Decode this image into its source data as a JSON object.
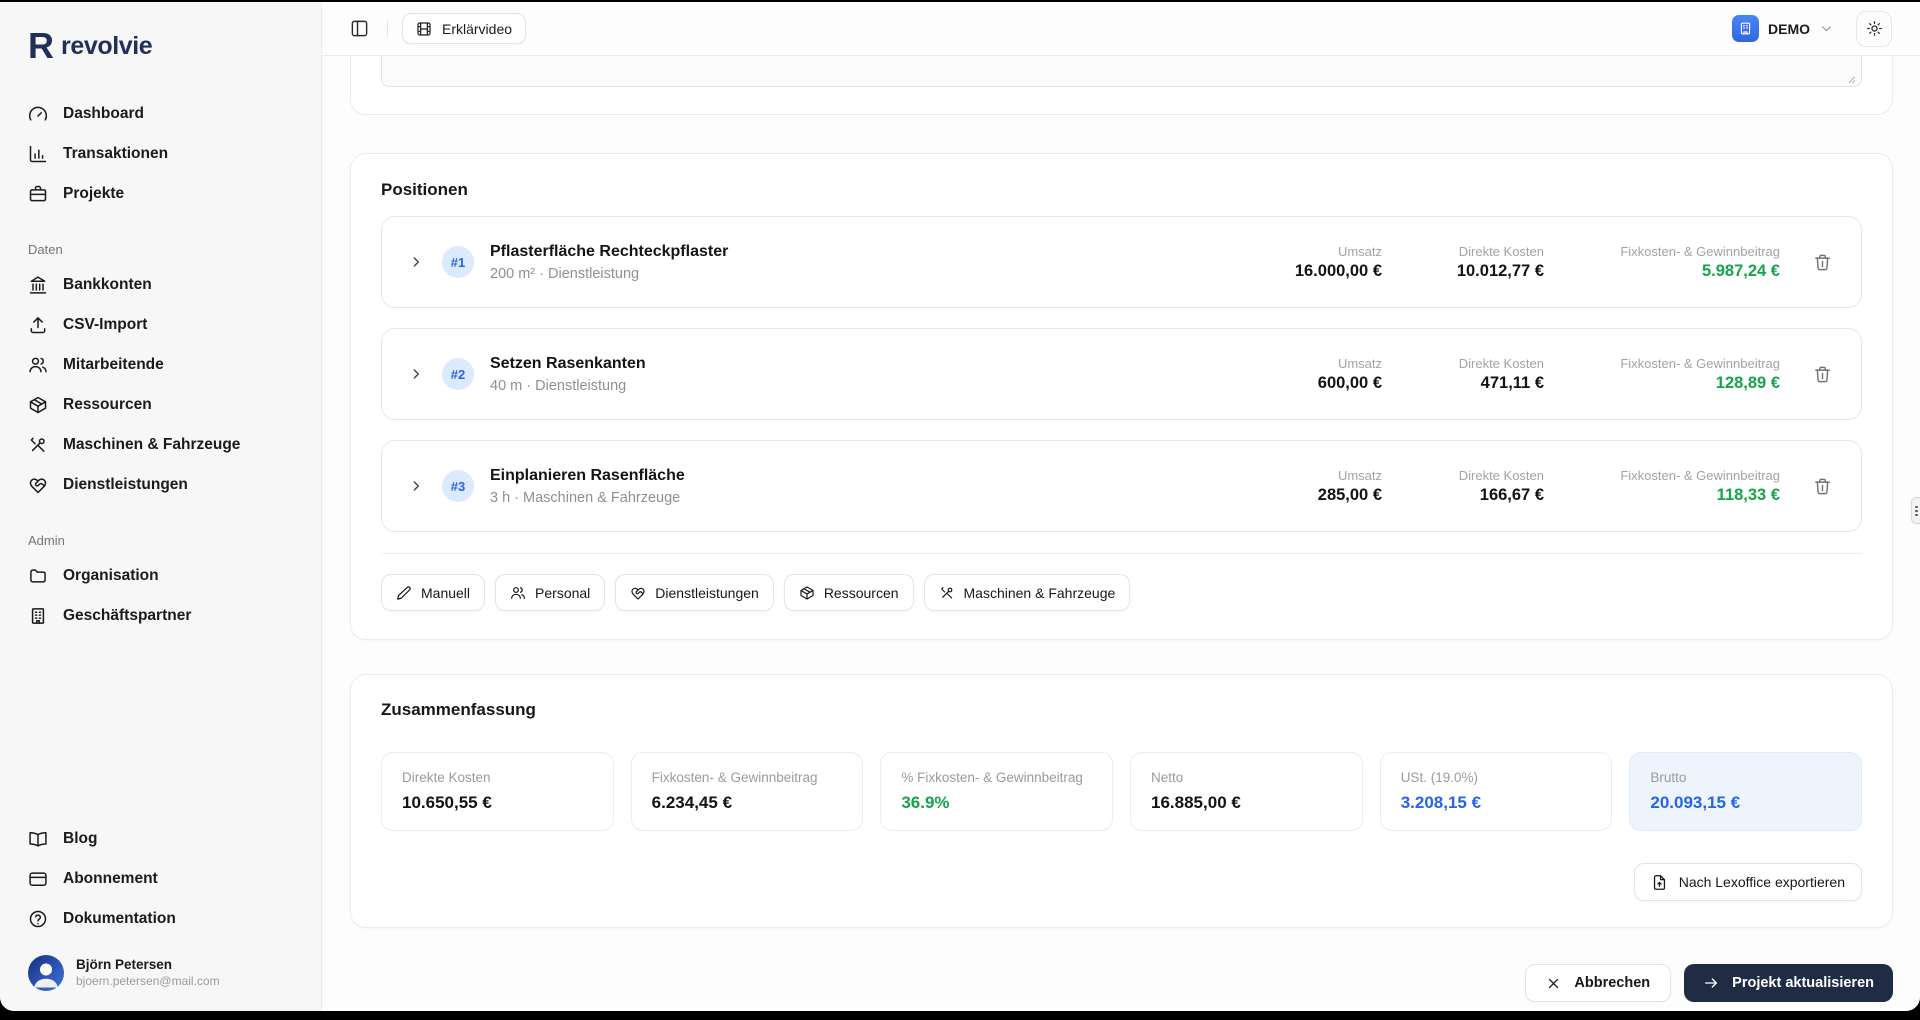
{
  "brand": {
    "logo_letter": "R",
    "name": "revolvie"
  },
  "topbar": {
    "video_button": "Erklärvideo",
    "org_name": "DEMO"
  },
  "sidebar": {
    "nav": [
      "Dashboard",
      "Transaktionen",
      "Projekte"
    ],
    "daten_label": "Daten",
    "daten": [
      "Bankkonten",
      "CSV-Import",
      "Mitarbeitende",
      "Ressourcen",
      "Maschinen & Fahrzeuge",
      "Dienstleistungen"
    ],
    "admin_label": "Admin",
    "admin": [
      "Organisation",
      "Geschäftspartner"
    ],
    "footer": [
      "Blog",
      "Abonnement",
      "Dokumentation"
    ],
    "user": {
      "name": "Björn Petersen",
      "email": "bjoern.petersen@mail.com"
    }
  },
  "positions": {
    "title": "Positionen",
    "columns": {
      "umsatz": "Umsatz",
      "kosten": "Direkte Kosten",
      "beitrag": "Fixkosten- & Gewinnbeitrag"
    },
    "rows": [
      {
        "num": "#1",
        "title": "Pflasterfläche Rechteckpflaster",
        "subtitle": "200 m² · Dienstleistung",
        "umsatz": "16.000,00 €",
        "kosten": "10.012,77 €",
        "beitrag": "5.987,24 €"
      },
      {
        "num": "#2",
        "title": "Setzen Rasenkanten",
        "subtitle": "40 m · Dienstleistung",
        "umsatz": "600,00 €",
        "kosten": "471,11 €",
        "beitrag": "128,89 €"
      },
      {
        "num": "#3",
        "title": "Einplanieren Rasenfläche",
        "subtitle": "3 h · Maschinen & Fahrzeuge",
        "umsatz": "285,00 €",
        "kosten": "166,67 €",
        "beitrag": "118,33 €"
      }
    ],
    "add_buttons": [
      "Manuell",
      "Personal",
      "Dienstleistungen",
      "Ressourcen",
      "Maschinen & Fahrzeuge"
    ]
  },
  "summary": {
    "title": "Zusammenfassung",
    "stats": [
      {
        "label": "Direkte Kosten",
        "value": "10.650,55 €"
      },
      {
        "label": "Fixkosten- & Gewinnbeitrag",
        "value": "6.234,45 €"
      },
      {
        "label": "% Fixkosten- & Gewinnbeitrag",
        "value": "36.9%"
      },
      {
        "label": "Netto",
        "value": "16.885,00 €"
      },
      {
        "label": "USt. (19.0%)",
        "value": "3.208,15 €"
      },
      {
        "label": "Brutto",
        "value": "20.093,15 €"
      }
    ],
    "export_button": "Nach Lexoffice exportieren"
  },
  "actions": {
    "cancel": "Abbrechen",
    "submit": "Projekt aktualisieren"
  },
  "colors": {
    "green": "#16a34a",
    "blue": "#2563eb",
    "navy_button": "#202b44",
    "brand_navy": "#223059",
    "badge_bg": "#dbeafe",
    "highlight_bg": "#edf4fd"
  }
}
